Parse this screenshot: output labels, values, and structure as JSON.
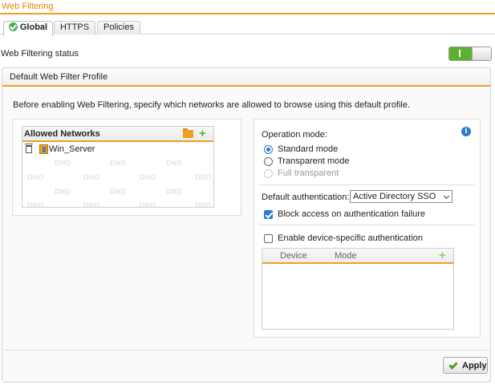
{
  "page": {
    "title": "Web Filtering"
  },
  "tabs": [
    {
      "label": "Global",
      "active": true,
      "icon": "check-circle-icon"
    },
    {
      "label": "HTTPS",
      "active": false
    },
    {
      "label": "Policies",
      "active": false
    }
  ],
  "status": {
    "label": "Web Filtering status",
    "enabled": true,
    "accent": "#5cb130"
  },
  "profile": {
    "header": "Default Web Filter Profile",
    "intro": "Before enabling Web Filtering, specify which networks are allowed to browse using this default profile."
  },
  "networks": {
    "header": "Allowed Networks",
    "items": [
      {
        "name": "Win_Server",
        "icon": "server-icon"
      }
    ],
    "watermark": "DND"
  },
  "operation": {
    "label": "Operation mode:",
    "modes": [
      {
        "label": "Standard mode",
        "selected": true,
        "disabled": false
      },
      {
        "label": "Transparent mode",
        "selected": false,
        "disabled": false
      },
      {
        "label": "Full transparent",
        "selected": false,
        "disabled": true
      }
    ],
    "auth_label": "Default authentication:",
    "auth_value": "Active Directory SSO",
    "block_label": "Block access on authentication failure",
    "block_checked": true,
    "device_auth_label": "Enable device-specific authentication",
    "device_auth_checked": false,
    "table": {
      "col_device": "Device",
      "col_mode": "Mode",
      "rows": []
    }
  },
  "footer": {
    "apply_label": "Apply"
  },
  "colors": {
    "accent_orange": "#f0a020",
    "title_orange": "#e08a00",
    "selection_blue": "#2a7ad2"
  }
}
